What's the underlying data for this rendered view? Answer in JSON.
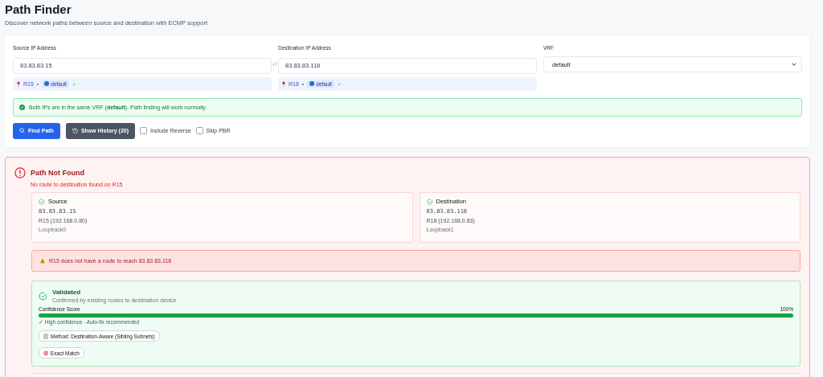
{
  "page": {
    "title": "Path Finder",
    "subtitle": "Discover network paths between source and destination with ECMP support"
  },
  "form": {
    "source": {
      "label": "Source IP Address",
      "value": "83.83.83.15",
      "router": "R15",
      "separator": "•",
      "vrf": "default",
      "mark": "✓"
    },
    "destination": {
      "label": "Destination IP Address",
      "value": "83.83.83.118",
      "router": "R18",
      "separator": "•",
      "vrf": "default",
      "mark": "✓"
    },
    "vrf": {
      "label": "VRF",
      "value": "default"
    },
    "notice": "Both IPs are in the same VRF (**default**). Path finding will work normally.",
    "buttons": [
      {
        "label": "Find Path",
        "kind": "primary"
      },
      {
        "label": "Show History (20)",
        "kind": "secondary"
      }
    ],
    "options": [
      {
        "label": "Include Reverse",
        "checked": false
      },
      {
        "label": "Skip PBR",
        "checked": false
      }
    ]
  },
  "result": {
    "title": "Path Not Found",
    "message": "No route to destination found on R15",
    "endpoints": [
      {
        "heading": "Source",
        "ip": "83.83.83.15",
        "router": "R15 (192.168.0.80)",
        "interface": "Loopback0"
      },
      {
        "heading": "Destination",
        "ip": "83.83.83.118",
        "router": "R18 (192.168.0.83)",
        "interface": "Loopback1"
      }
    ],
    "warning": "R15 does not have a route to reach 83.83.83.118",
    "validation": {
      "title": "Validated",
      "subtitle": "Confirmed by existing routes to destination device",
      "confidence_label": "Confidence Score",
      "confidence_value": "100%",
      "level": 1,
      "note": "✓ High confidence - Auto-fix recommended",
      "tags": [
        {
          "label": "Method: Destination-Aware (Sibling Subnets)",
          "kind": "method"
        },
        {
          "label": "Exact Match",
          "kind": "match"
        }
      ]
    }
  }
}
